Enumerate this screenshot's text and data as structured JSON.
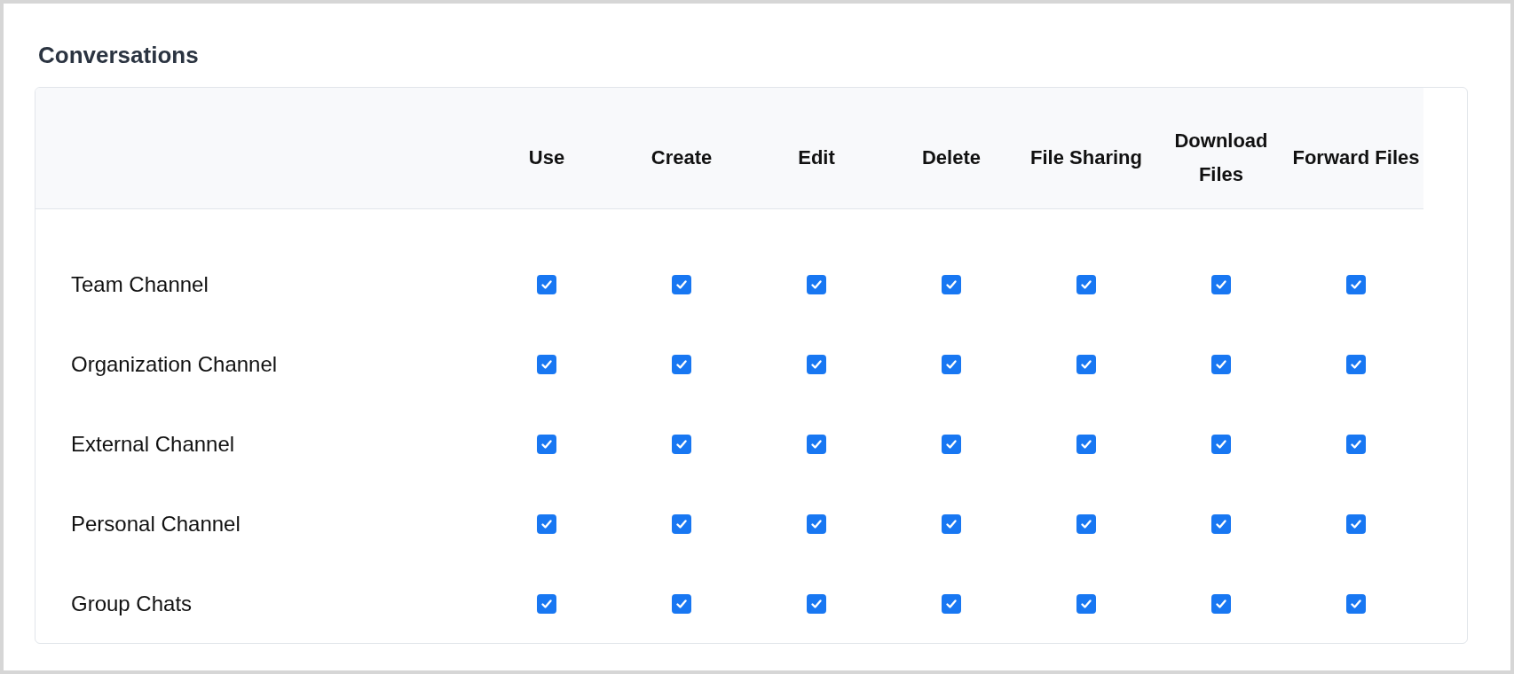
{
  "section": {
    "title": "Conversations"
  },
  "table": {
    "columns": [
      "Use",
      "Create",
      "Edit",
      "Delete",
      "File Sharing",
      "Download Files",
      "Forward Files"
    ],
    "rows": [
      {
        "label": "Team Channel",
        "permissions": [
          {
            "checked": true
          },
          {
            "checked": true
          },
          {
            "checked": true
          },
          {
            "checked": true
          },
          {
            "checked": true
          },
          {
            "checked": true
          },
          {
            "checked": true
          }
        ]
      },
      {
        "label": "Organization Channel",
        "permissions": [
          {
            "checked": true
          },
          {
            "checked": true
          },
          {
            "checked": true
          },
          {
            "checked": true
          },
          {
            "checked": true
          },
          {
            "checked": true
          },
          {
            "checked": true
          }
        ]
      },
      {
        "label": "External Channel",
        "permissions": [
          {
            "checked": true
          },
          {
            "checked": true
          },
          {
            "checked": true
          },
          {
            "checked": true
          },
          {
            "checked": true
          },
          {
            "checked": true
          },
          {
            "checked": true
          }
        ]
      },
      {
        "label": "Personal Channel",
        "permissions": [
          {
            "checked": true
          },
          {
            "checked": true
          },
          {
            "checked": true
          },
          {
            "checked": true
          },
          {
            "checked": true
          },
          {
            "checked": true
          },
          {
            "checked": true
          }
        ]
      },
      {
        "label": "Group Chats",
        "permissions": [
          {
            "checked": true
          },
          {
            "checked": true
          },
          {
            "checked": true
          },
          {
            "checked": true
          },
          {
            "checked": true
          },
          {
            "checked": true
          },
          {
            "checked": true
          }
        ]
      }
    ]
  }
}
